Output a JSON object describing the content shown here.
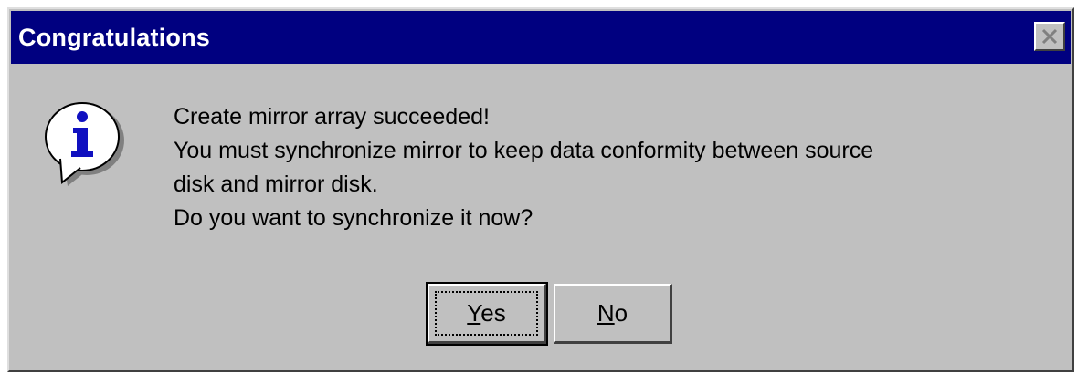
{
  "dialog": {
    "title": "Congratulations",
    "icon": "info-icon",
    "message_lines": [
      "Create mirror array succeeded!",
      "You must synchronize mirror to keep data conformity between source",
      "disk and mirror disk.",
      "Do you want to synchronize it now?"
    ],
    "buttons": {
      "yes": {
        "mnemonic": "Y",
        "rest": "es"
      },
      "no": {
        "mnemonic": "N",
        "rest": "o"
      }
    }
  }
}
